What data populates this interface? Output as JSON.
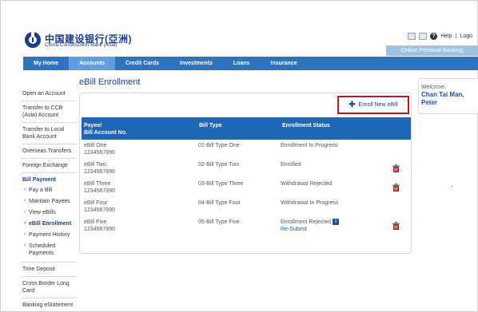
{
  "header": {
    "logo_cn": "中国建设银行(亞洲)",
    "logo_en": "China Construction Bank (Asia)",
    "help_label": "Help",
    "logout_label": "Logo",
    "online_tab": "Online Personal Banking"
  },
  "nav": [
    {
      "label": "My Home"
    },
    {
      "label": "Accounts"
    },
    {
      "label": "Credit Cards"
    },
    {
      "label": "Investments"
    },
    {
      "label": "Loans"
    },
    {
      "label": "Insurance"
    }
  ],
  "sidebar": {
    "items": [
      {
        "label": "Open an Account"
      },
      {
        "label": "Transfer to CCB (Asia) Account"
      },
      {
        "label": "Transfer to Local Bank Account"
      },
      {
        "label": "Overseas Transfers"
      },
      {
        "label": "Foreign Exchange"
      }
    ],
    "bill_payment": {
      "label": "Bill Payment",
      "subitems": [
        {
          "label": "Pay a Bill"
        },
        {
          "label": "Maintain Payees"
        },
        {
          "label": "View eBills"
        },
        {
          "label": "eBill Enrollment"
        },
        {
          "label": "Payment History"
        },
        {
          "label": "Scheduled Payments"
        }
      ]
    },
    "items_after": [
      {
        "label": "Time Deposit"
      },
      {
        "label": "Cross Border Long Card"
      },
      {
        "label": "Banking eStatement"
      }
    ]
  },
  "main": {
    "title": "eBill Enrollment",
    "enroll_button": "Enroll New eBill",
    "table": {
      "headers": {
        "payee_line1": "Payee/",
        "payee_line2": "Bill Account No.",
        "bill_type": "Bill Type",
        "status": "Enrollment Status"
      },
      "rows": [
        {
          "payee": "eBill One",
          "account": "1234567890",
          "bill_type": "01-Bill Type One",
          "status": "Enrollment In Progress"
        },
        {
          "payee": "eBill Two",
          "account": "1234567890",
          "bill_type": "02-Bill Type Two",
          "status": "Enrolled"
        },
        {
          "payee": "eBill Three",
          "account": "1234567890",
          "bill_type": "03-Bill Type Three",
          "status": "Withdrawal Rejected"
        },
        {
          "payee": "eBill Four",
          "account": "1234567890",
          "bill_type": "04-Bill Type Four",
          "status": "Withdrawal In Progress"
        },
        {
          "payee": "eBill Five",
          "account": "1234567890",
          "bill_type": "05-Bill Type Five",
          "status": "Enrollment Rejected",
          "action": "Re-Submit"
        }
      ]
    }
  },
  "welcome": {
    "label": "Welcome,",
    "name": "Chan Tai Man, Peter"
  },
  "colors": {
    "nav_bar": "#2b74c0",
    "nav_active": "#5d9ee0",
    "table_header": "#1e66b8",
    "highlight_border": "#c0161e",
    "brand": "#1a3c8c"
  }
}
